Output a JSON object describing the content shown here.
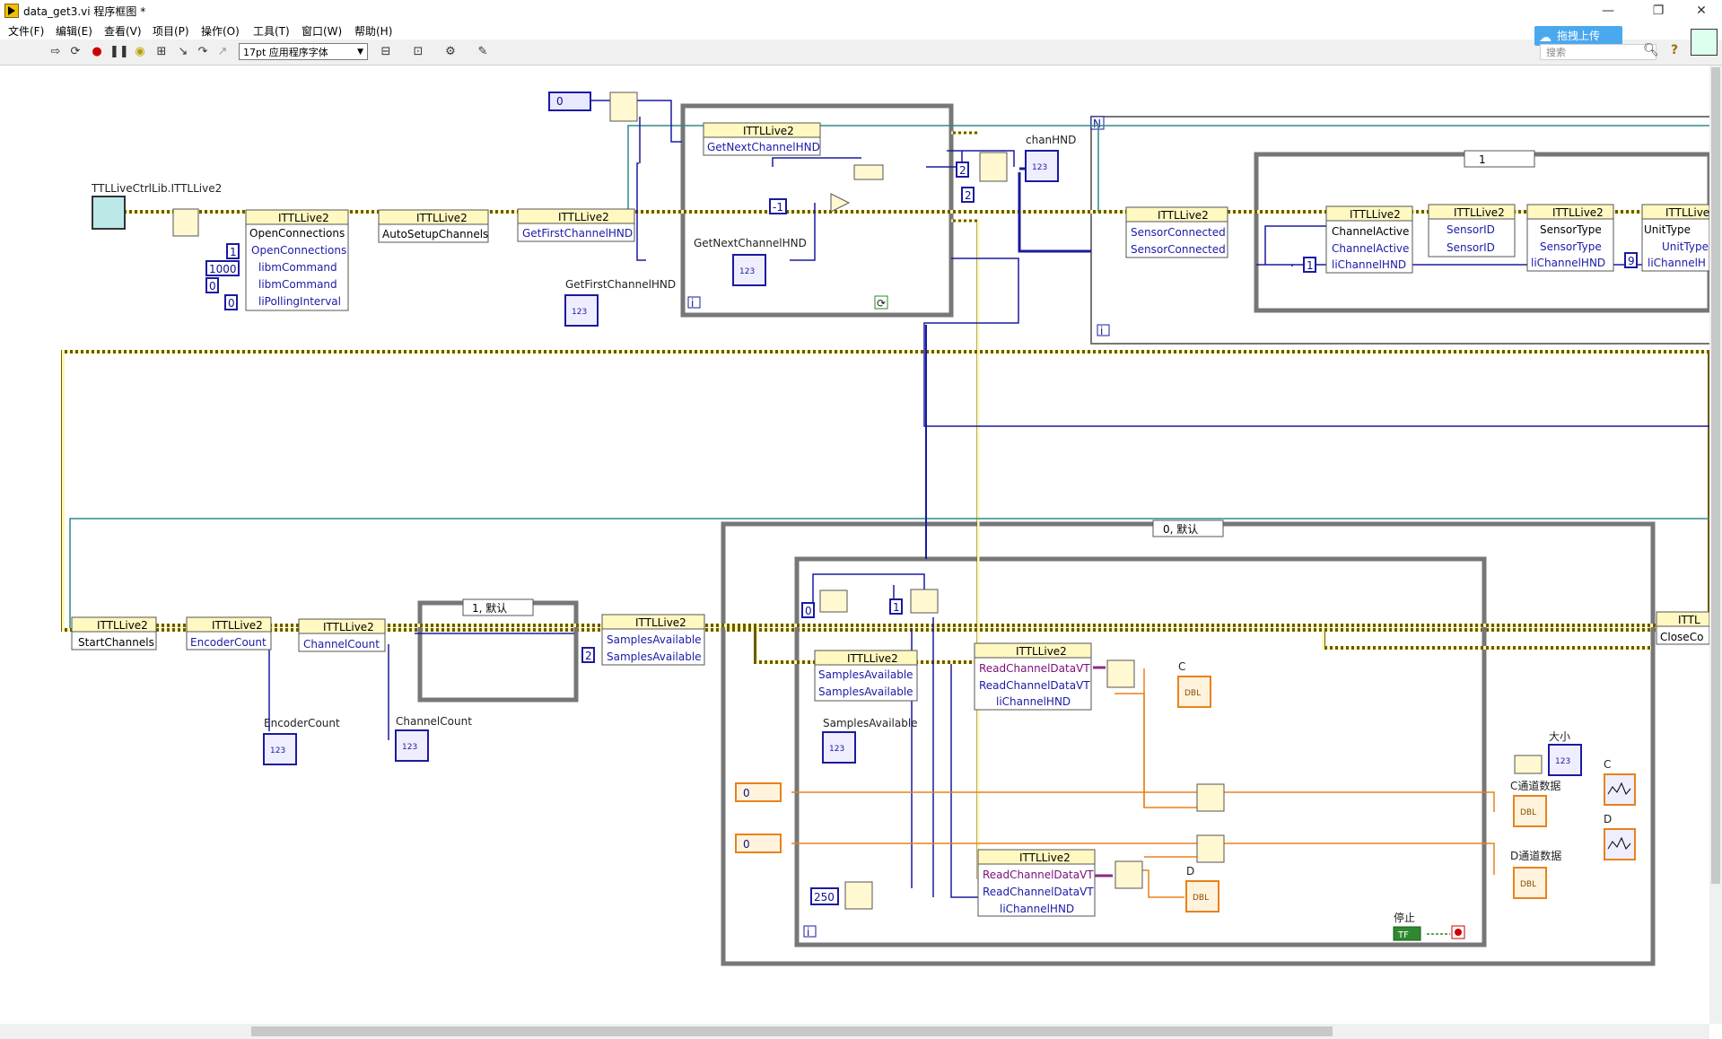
{
  "window": {
    "title": "data_get3.vi 程序框图 *",
    "minimize": "—",
    "restore": "❐",
    "close": "✕"
  },
  "menu": [
    "文件(F)",
    "编辑(E)",
    "查看(V)",
    "项目(P)",
    "操作(O)",
    "工具(T)",
    "窗口(W)",
    "帮助(H)"
  ],
  "toolbar": {
    "font": "17pt 应用程序字体",
    "upload": "拖拽上传",
    "search_placeholder": "搜索"
  },
  "labels": {
    "lib": "TTLLiveCtrlLib.ITTLLive2",
    "get_first": "GetFirstChannelHND",
    "get_next": "GetNextChannelHND",
    "chan_hnd": "chanHND",
    "encoder_count": "EncoderCount",
    "channel_count": "ChannelCount",
    "samples_available": "SamplesAvailable",
    "size": "大小",
    "c": "C",
    "d": "D",
    "c_data": "C通道数据",
    "d_data": "D通道数据",
    "stop": "停止"
  },
  "nodes": {
    "class": "ITTLLive2",
    "class_short": "ITTLLive",
    "class_clip": "ITTL",
    "open_connections": "OpenConnections",
    "libm_command": "libmCommand",
    "li_polling_interval": "liPollingInterval",
    "auto_setup": "AutoSetupChannels",
    "get_first": "GetFirstChannelHND",
    "get_next": "GetNextChannelHND",
    "sensor_connected": "SensorConnected",
    "channel_active": "ChannelActive",
    "sensor_id": "SensorID",
    "sensor_type": "SensorType",
    "li_channel_hnd": "liChannelHND",
    "li_channel_hnd_clip": "liChannelH",
    "unit_type": "UnitType",
    "start_channels": "StartChannels",
    "encoder_count": "EncoderCount",
    "channel_count": "ChannelCount",
    "samples_available": "SamplesAvailable",
    "read_channel_data": "ReadChannelDataVT",
    "close_clip": "CloseCo"
  },
  "constants": {
    "zero": "0",
    "one": "1",
    "two": "2",
    "nine": "9",
    "thousand": "1000",
    "neg_one": "-1",
    "ms250": "250",
    "n": "N",
    "i": "i",
    "tf": "TF",
    "num_icon": "123",
    "dbl": "DBL"
  },
  "cases": {
    "top": "1",
    "mid": "1, 默认",
    "bottom": "0, 默认"
  }
}
